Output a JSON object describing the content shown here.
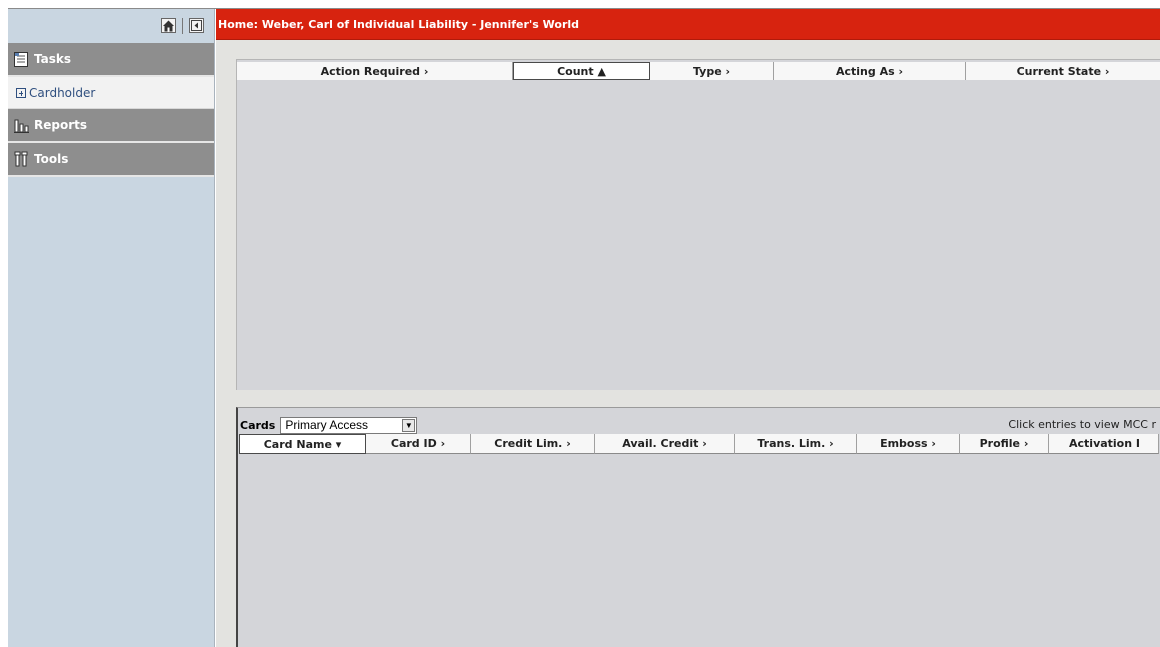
{
  "title": "Home: Weber, Carl of Individual Liability - Jennifer's World",
  "sidebar": {
    "sections": [
      {
        "label": "Tasks"
      },
      {
        "label": "Reports"
      },
      {
        "label": "Tools"
      }
    ],
    "cardholder": "Cardholder"
  },
  "tasks_table": {
    "columns": [
      {
        "label": "Action Required ›"
      },
      {
        "label": "Count ▲"
      },
      {
        "label": "Type ›"
      },
      {
        "label": "Acting As ›"
      },
      {
        "label": "Current State ›"
      }
    ]
  },
  "cards": {
    "label": "Cards",
    "select_value": "Primary Access",
    "hint": "Click entries to view MCC r",
    "columns": [
      {
        "label": "Card Name ▾"
      },
      {
        "label": "Card ID ›"
      },
      {
        "label": "Credit Lim. ›"
      },
      {
        "label": "Avail. Credit ›"
      },
      {
        "label": "Trans. Lim. ›"
      },
      {
        "label": "Emboss ›"
      },
      {
        "label": "Profile ›"
      },
      {
        "label": "Activation I"
      }
    ]
  },
  "colors": {
    "title_bar": "#d7230f",
    "sidebar": "#c9d6e1",
    "section": "#8e8e8e"
  }
}
